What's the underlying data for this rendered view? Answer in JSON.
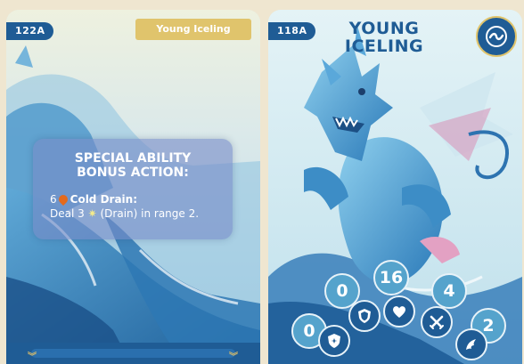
{
  "left_card": {
    "number": "122A",
    "banner": "Young Iceling",
    "ability": {
      "heading_line1": "SPECIAL ABILITY",
      "heading_line2": "BONUS ACTION:",
      "cost": "6",
      "name": "Cold Drain:",
      "effect_prefix": "Deal 3",
      "effect_suffix": "(Drain) in range 2."
    }
  },
  "right_card": {
    "number": "118A",
    "title_line1": "YOUNG",
    "title_line2": "ICELING",
    "stats": {
      "defense_value": "0",
      "shield_value": "0",
      "health_value": "16",
      "attack_value": "4",
      "move_value": "2"
    },
    "icons": [
      "sea-emblem-icon",
      "defense-icon",
      "shield-icon",
      "heart-icon",
      "crossed-swords-icon",
      "wing-icon"
    ]
  },
  "colors": {
    "primary_blue": "#1f5c95",
    "gold": "#e0c46c",
    "stat_blue": "#55a3cc",
    "drain_gem": "#e46a1d"
  }
}
